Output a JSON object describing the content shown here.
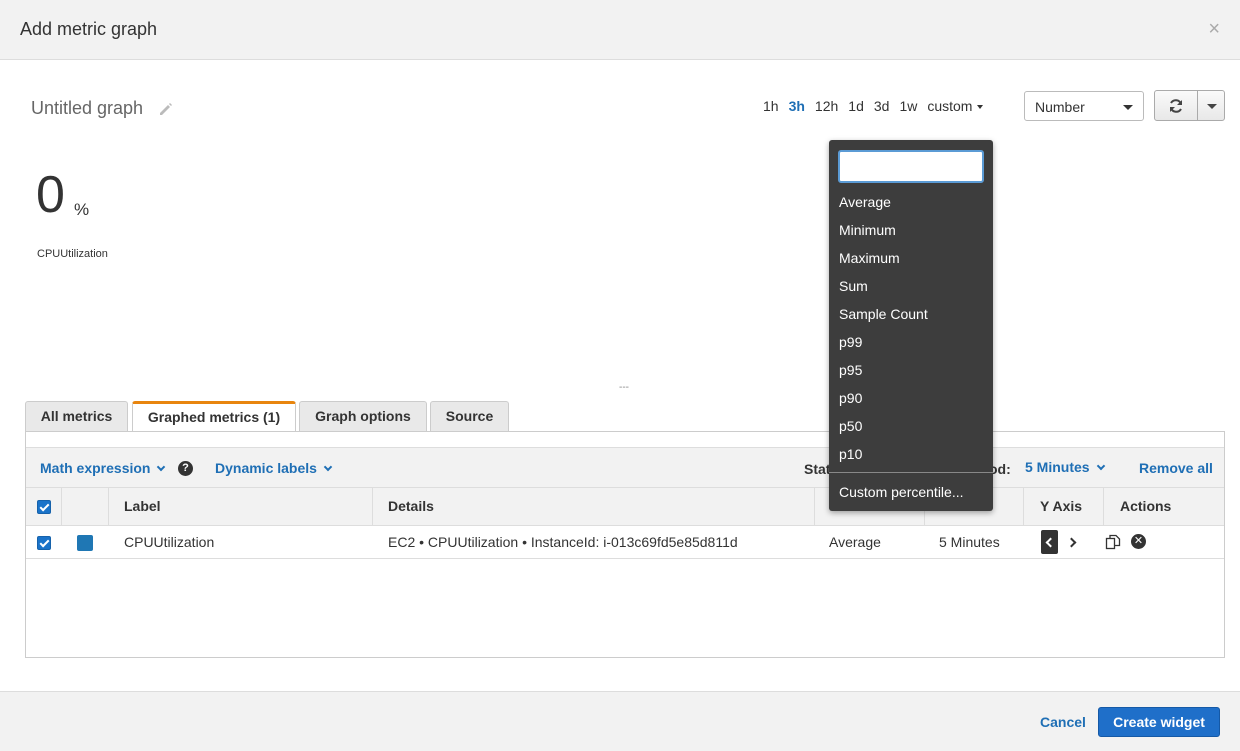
{
  "modal": {
    "title": "Add metric graph",
    "close_glyph": "×"
  },
  "graph": {
    "title": "Untitled graph",
    "value": "0",
    "unit": "%",
    "metric_label": "CPUUtilization",
    "resize_glyph": "---"
  },
  "time_ranges": {
    "items": [
      "1h",
      "3h",
      "12h",
      "1d",
      "3d",
      "1w"
    ],
    "active": "3h",
    "custom_label": "custom"
  },
  "view_select": {
    "value": "Number"
  },
  "tabs": [
    {
      "label": "All metrics"
    },
    {
      "label": "Graphed metrics (1)"
    },
    {
      "label": "Graph options"
    },
    {
      "label": "Source"
    }
  ],
  "toolbar": {
    "math_expression": "Math expression",
    "help_glyph": "?",
    "dynamic_labels": "Dynamic labels",
    "statistic_partial": "Stat",
    "period_partial": "od:",
    "period_value": "5 Minutes",
    "remove_all": "Remove all"
  },
  "table": {
    "headers": {
      "label": "Label",
      "details": "Details",
      "y_axis": "Y Axis",
      "actions": "Actions"
    },
    "rows": [
      {
        "label": "CPUUtilization",
        "details_namespace": "EC2",
        "details_metric": "CPUUtilization",
        "details_dimension": "InstanceId: i-013c69fd5e85d811d",
        "statistic": "Average",
        "period": "5 Minutes",
        "color": "#1f77b4"
      }
    ]
  },
  "statistic_dropdown": {
    "search_value": "",
    "options": [
      "Average",
      "Minimum",
      "Maximum",
      "Sum",
      "Sample Count",
      "p99",
      "p95",
      "p90",
      "p50",
      "p10"
    ],
    "custom_option": "Custom percentile..."
  },
  "footer": {
    "cancel": "Cancel",
    "create": "Create widget"
  },
  "colors": {
    "accent": "#1f6fb5",
    "tab_active_border": "#e8850e",
    "dropdown_bg": "#3d3d3d",
    "series": "#1f77b4"
  }
}
